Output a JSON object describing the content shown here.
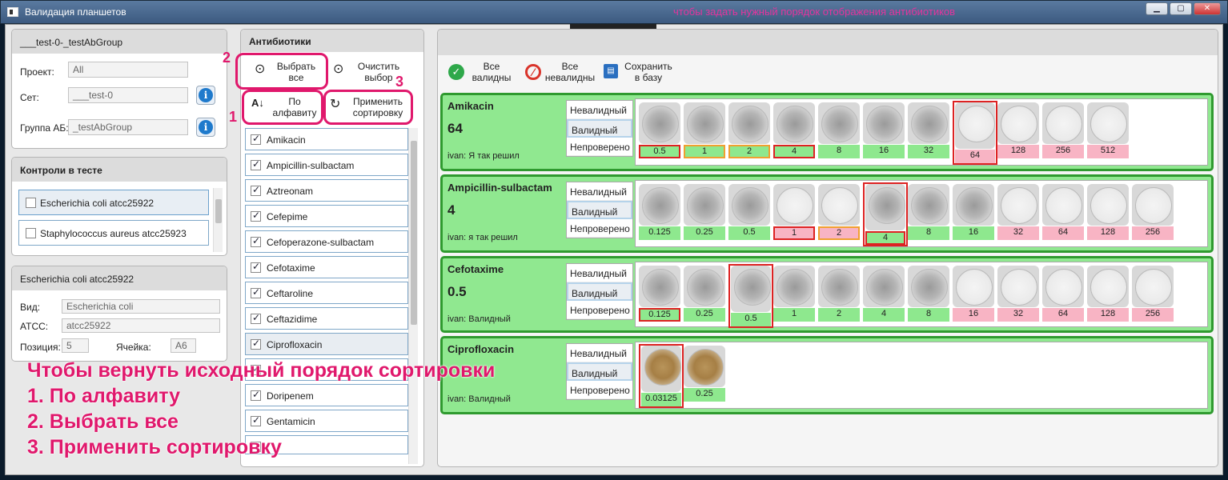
{
  "window": {
    "title": "Валидация планшетов",
    "overlay_caption": "чтобы задать нужный порядок отображения антибиотиков",
    "minimize": "▁",
    "maximize": "▢",
    "close": "✕"
  },
  "group_panel": {
    "title": "___test-0-_testAbGroup",
    "project_label": "Проект:",
    "project_value": "All",
    "set_label": "Сет:",
    "set_value": "___test-0",
    "group_label": "Группа АБ:",
    "group_value": "_testAbGroup"
  },
  "controls_panel": {
    "title": "Контроли в тесте",
    "items": [
      "Escherichia coli atcc25922",
      "Staphylococcus aureus atcc25923"
    ]
  },
  "strain_panel": {
    "title": "Escherichia coli atcc25922",
    "species_label": "Вид:",
    "species_value": "Escherichia coli",
    "atcc_label": "ATCC:",
    "atcc_value": "atcc25922",
    "position_label": "Позиция:",
    "position_value": "5",
    "cell_label": "Ячейка:",
    "cell_value": "A6"
  },
  "antibiotics_panel": {
    "title": "Антибиотики",
    "select_all": "Выбрать все",
    "clear_selection": "Очистить выбор",
    "alphabet": "По алфавиту",
    "apply_sort": "Применить сортировку",
    "items": [
      "Amikacin",
      "Ampicillin-sulbactam",
      "Aztreonam",
      "Cefepime",
      "Cefoperazone-sulbactam",
      "Cefotaxime",
      "Ceftaroline",
      "Ceftazidime",
      "Ciprofloxacin",
      "",
      "Doripenem",
      "Gentamicin",
      ""
    ]
  },
  "toolbar": {
    "all_valid": "Все валидны",
    "all_invalid": "Все невалидны",
    "save": "Сохранить в базу"
  },
  "states": {
    "invalid": "Невалидный",
    "valid": "Валидный",
    "unchecked": "Непроверено"
  },
  "cards": [
    {
      "name": "Amikacin",
      "mic": "64",
      "note": "ivan:  Я так решил",
      "wells": [
        {
          "c": "0.5",
          "k": "g",
          "b": "r",
          "d": ""
        },
        {
          "c": "1",
          "k": "g",
          "b": "o",
          "d": ""
        },
        {
          "c": "2",
          "k": "g",
          "b": "o",
          "d": ""
        },
        {
          "c": "4",
          "k": "g",
          "b": "r",
          "d": ""
        },
        {
          "c": "8",
          "k": "g",
          "b": "",
          "d": ""
        },
        {
          "c": "16",
          "k": "g",
          "b": "",
          "d": ""
        },
        {
          "c": "32",
          "k": "g",
          "b": "",
          "d": ""
        },
        {
          "c": "64",
          "k": "p",
          "b": "",
          "d": "clear",
          "s": true
        },
        {
          "c": "128",
          "k": "p",
          "b": "",
          "d": "clear"
        },
        {
          "c": "256",
          "k": "p",
          "b": "",
          "d": "clear"
        },
        {
          "c": "512",
          "k": "p",
          "b": "",
          "d": "clear"
        }
      ]
    },
    {
      "name": "Ampicillin-sulbactam",
      "mic": "4",
      "note": "ivan:  я так решил",
      "wells": [
        {
          "c": "0.125",
          "k": "g",
          "b": "",
          "d": ""
        },
        {
          "c": "0.25",
          "k": "g",
          "b": "",
          "d": ""
        },
        {
          "c": "0.5",
          "k": "g",
          "b": "",
          "d": ""
        },
        {
          "c": "1",
          "k": "p",
          "b": "r",
          "d": "clear"
        },
        {
          "c": "2",
          "k": "p",
          "b": "o",
          "d": "clear"
        },
        {
          "c": "4",
          "k": "g",
          "b": "r",
          "d": "",
          "s": true
        },
        {
          "c": "8",
          "k": "g",
          "b": "",
          "d": ""
        },
        {
          "c": "16",
          "k": "g",
          "b": "",
          "d": ""
        },
        {
          "c": "32",
          "k": "p",
          "b": "",
          "d": "clear"
        },
        {
          "c": "64",
          "k": "p",
          "b": "",
          "d": "clear"
        },
        {
          "c": "128",
          "k": "p",
          "b": "",
          "d": "clear"
        },
        {
          "c": "256",
          "k": "p",
          "b": "",
          "d": "clear"
        }
      ]
    },
    {
      "name": "Cefotaxime",
      "mic": "0.5",
      "note": "ivan:  Валидный",
      "wells": [
        {
          "c": "0.125",
          "k": "g",
          "b": "r",
          "d": ""
        },
        {
          "c": "0.25",
          "k": "g",
          "b": "",
          "d": ""
        },
        {
          "c": "0.5",
          "k": "g",
          "b": "",
          "d": "",
          "s": true
        },
        {
          "c": "1",
          "k": "g",
          "b": "",
          "d": ""
        },
        {
          "c": "2",
          "k": "g",
          "b": "",
          "d": ""
        },
        {
          "c": "4",
          "k": "g",
          "b": "",
          "d": ""
        },
        {
          "c": "8",
          "k": "g",
          "b": "",
          "d": ""
        },
        {
          "c": "16",
          "k": "p",
          "b": "",
          "d": "clear"
        },
        {
          "c": "32",
          "k": "p",
          "b": "",
          "d": "clear"
        },
        {
          "c": "64",
          "k": "p",
          "b": "",
          "d": "clear"
        },
        {
          "c": "128",
          "k": "p",
          "b": "",
          "d": "clear"
        },
        {
          "c": "256",
          "k": "p",
          "b": "",
          "d": "clear"
        }
      ]
    },
    {
      "name": "Ciprofloxacin",
      "mic": "",
      "note": "ivan:  Валидный",
      "wells": [
        {
          "c": "0.03125",
          "k": "g",
          "b": "",
          "d": "brown",
          "s": true
        },
        {
          "c": "0.25",
          "k": "g",
          "b": "",
          "d": "brown"
        }
      ]
    }
  ],
  "annotation": {
    "title": "Чтобы вернуть исходный порядок сортировки",
    "step1": "1. По алфавиту",
    "step2": "2. Выбрать все",
    "step3": "3. Применить сортировку",
    "n1": "1",
    "n2": "2",
    "n3": "3"
  },
  "colors": {
    "valid_green": "#90e890",
    "border_green": "#2f9a2f",
    "invalid_pink": "#f8b4c4",
    "annotation_pink": "#e0186c"
  }
}
